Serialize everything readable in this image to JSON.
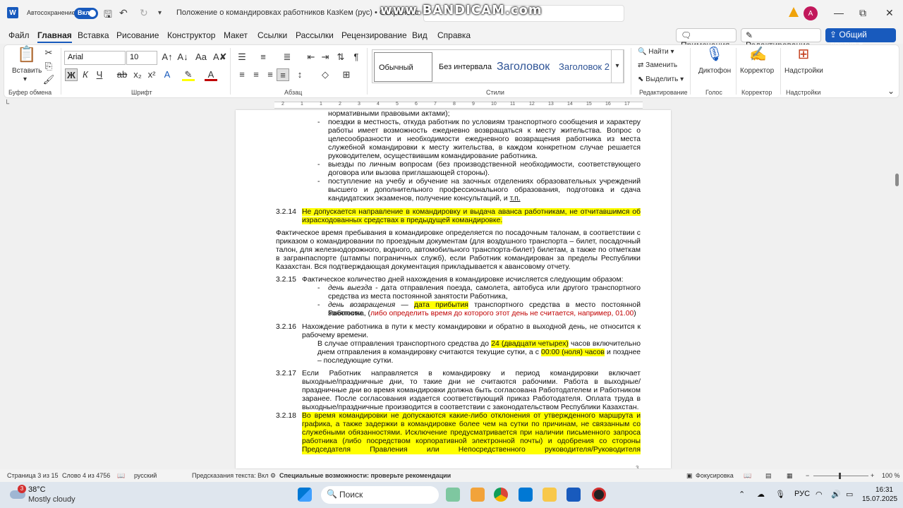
{
  "window": {
    "autosave_label": "Автосохранение",
    "autosave_state": "Вкл",
    "title": "Положение о командировках работников КазКем (рус) • Сохранено",
    "watermark": "www.BANDICAM.com",
    "avatar_initial": "A"
  },
  "menu": {
    "tabs": [
      "Файл",
      "Главная",
      "Вставка",
      "Рисование",
      "Конструктор",
      "Макет",
      "Ссылки",
      "Рассылки",
      "Рецензирование",
      "Вид",
      "Справка"
    ],
    "comments": "Примечания",
    "editing_mode": "Редактирование",
    "share": "Общий доступ"
  },
  "ribbon": {
    "clipboard": {
      "paste": "Вставить",
      "label": "Буфер обмена"
    },
    "font": {
      "name": "Arial",
      "size": "10",
      "label": "Шрифт"
    },
    "paragraph": {
      "label": "Абзац"
    },
    "styles": {
      "items": [
        "Обычный",
        "Без интервала",
        "Заголовок",
        "Заголовок 2"
      ],
      "label": "Стили"
    },
    "editing": {
      "find": "Найти",
      "replace": "Заменить",
      "select": "Выделить",
      "label": "Редактирование"
    },
    "voice": {
      "dictate": "Диктофон",
      "label": "Голос"
    },
    "editor": {
      "name": "Корректор",
      "label": "Корректор"
    },
    "addins": {
      "name": "Надстройки",
      "label": "Надстройки"
    }
  },
  "ruler": {
    "numbers": [
      "2",
      "1",
      "1",
      "2",
      "3",
      "4",
      "5",
      "6",
      "7",
      "8",
      "9",
      "10",
      "11",
      "12",
      "13",
      "14",
      "15",
      "16",
      "17"
    ]
  },
  "document": {
    "l01": "нормативными правовыми актами);",
    "l02": "поездки в местность, откуда работник по условиям транспортного сообщения и характеру",
    "l03": "работы имеет возможность ежедневно возвращаться к месту жительства. Вопрос о",
    "l04": "целесообразности и необходимости ежедневного возвращения работника из места",
    "l05": "служебной командировки к месту жительства, в каждом конкретном случае решается",
    "l06": "руководителем, осуществившим командирование работника.",
    "l07": "выезды по личным вопросам (без производственной необходимости, соответствующего",
    "l08": "договора или вызова приглашающей стороны).",
    "l09": "поступление на учебу и обучение на заочных отделениях образовательных учреждений",
    "l10": "высшего и дополнительного профессионального образования, подготовка и сдача",
    "l11a": "кандидатских экзаменов, получение консультаций, и ",
    "l11b": "т.п.",
    "n214": "3.2.14",
    "l12": "Не допускается направление в командировку и выдача аванса работникам, не отчитавшимся об",
    "l13": "израсходованных средствах в предыдущей командировке.",
    "l14": "Фактическое время пребывания в командировке определяется по посадочным талонам, в соответствии с",
    "l15": "приказом о командировании по проездным документам (для воздушного транспорта – билет, посадочный",
    "l16": "талон, для железнодорожного, водного, автомобильного транспорта-билет) билетам, а также по отметкам",
    "l17": "в загранпаспорте (штампы пограничных служб), если Работник командирован за пределы Республики",
    "l18": "Казахстан. Вся подтверждающая документация прикладывается к авансовому отчету.",
    "n215": "3.2.15",
    "l19": "Фактическое количество дней нахождения в командировке исчисляется следующим образом:",
    "l20a": "день выезда",
    "l20b": " - дата отправления поезда, самолета, автобуса или другого транспортного",
    "l21": "средства из места постоянной занятости Работника,",
    "l22a": "день возвращения",
    "l22b": " — ",
    "l22c": "дата прибытия",
    "l22d": " транспортного средства в место постоянной занятости",
    "l23a": "Работника, (",
    "l23b": "либо определить время до которого этот день не считается, например, 01.00",
    "l23c": ")",
    "n216": "3.2.16",
    "l24": "Нахождение работника в пути к месту командировки и обратно в выходной день, не относится к",
    "l25": "рабочему времени.",
    "l26a": "В случае отправления транспортного средства до ",
    "l26b": "24 (двадцати четырех)",
    "l26c": " часов включительно",
    "l27a": "днем отправления в командировку считаются текущие сутки, а с ",
    "l27b": "00:00 (ноля) часов",
    "l27c": " и позднее",
    "l28": "– последующие сутки.",
    "n217": "3.2.17",
    "l29": "Если Работник направляется в командировку и период командировки включает",
    "l30": "выходные/праздничные дни, то такие дни не считаются рабочими. Работа в выходные/",
    "l31": "праздничные дни во время командировки должна быть согласована Работодателем и Работником",
    "l32": "заранее. После согласования издается соответствующий приказ Работодателя. Оплата труда в",
    "l33": "выходные/праздничные производится в соответствии с законодательством Республики Казахстан.",
    "n218": "3.2.18",
    "l34": "Во время командировки не допускаются какие-либо отклонения от утвержденного маршрута и",
    "l35": "графика, а также задержки в командировке более чем на сутки по причинам, не связанным со",
    "l36": "служебными обязанностями. Исключение предусматривается при наличии письменного запроса",
    "l37": "работника (либо посредством корпоративной электронной почты) и одобрения со стороны",
    "l38": "Председателя Правления или Непосредственного руководителя/Руководителя",
    "page_no": "3",
    "dash": "-"
  },
  "statusbar": {
    "page": "Страница 3 из 15",
    "words": "Слово 4 из 4756",
    "language": "русский",
    "predictions": "Предсказания текста: Вкл",
    "accessibility": "Специальные возможности: проверьте рекомендации",
    "focus": "Фокусировка",
    "zoom": "100 %"
  },
  "taskbar": {
    "weather_badge": "3",
    "temp": "38°C",
    "weather": "Mostly cloudy",
    "search": "Поиск",
    "lang": "РУС",
    "time": "16:31",
    "date": "15.07.2025"
  },
  "colors": {
    "accent": "#185abd",
    "highlight": "#ffff00",
    "red_text": "#c00000"
  }
}
